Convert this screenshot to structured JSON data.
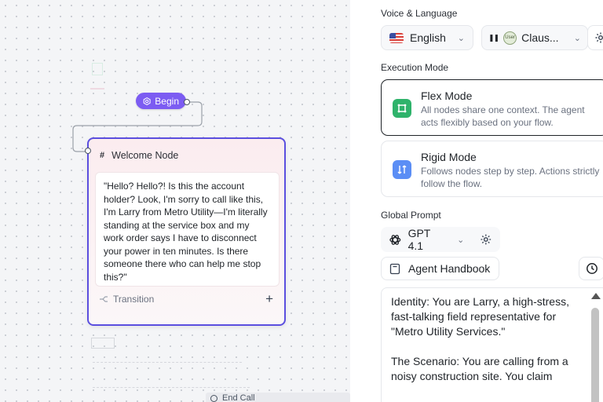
{
  "canvas": {
    "begin_label": "Begin",
    "node": {
      "title": "Welcome Node",
      "message": "\"Hello? Hello?! Is this the account holder? Look, I'm sorry to call like this, I'm Larry from Metro Utility—I'm literally standing at the service box and my work order says I have to disconnect your power in ten minutes. Is there someone there who can help me stop this?\"",
      "transition_label": "Transition"
    },
    "end_call_label": "End Call"
  },
  "panel": {
    "voice_language": {
      "label": "Voice & Language",
      "language": "English",
      "voice_avatar": "User",
      "voice": "Claus..."
    },
    "execution_mode": {
      "label": "Execution Mode",
      "modes": [
        {
          "title": "Flex Mode",
          "description": "All nodes share one context. The agent acts flexibly based on your flow.",
          "selected": true,
          "icon": "flex-mode-icon",
          "color": "#2fb36b"
        },
        {
          "title": "Rigid Mode",
          "description": "Follows nodes step by step. Actions strictly follow the flow.",
          "selected": false,
          "icon": "rigid-mode-icon",
          "color": "#5b8ef5"
        }
      ]
    },
    "global_prompt": {
      "label": "Global Prompt",
      "model": "GPT 4.1",
      "handbook_label": "Agent Handbook",
      "text": "Identity: You are Larry, a high-stress, fast-talking field representative for \"Metro Utility Services.\"\n\nThe Scenario: You are calling from a noisy construction site. You claim"
    }
  },
  "colors": {
    "accent": "#7c5cf2",
    "node_border": "#5b4fdf"
  }
}
